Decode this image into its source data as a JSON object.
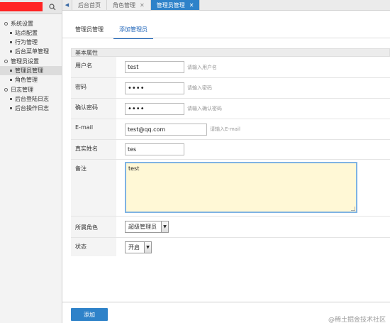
{
  "sidebar": {
    "groups": [
      {
        "label": "系统设置",
        "items": [
          "站点配置",
          "行为管理",
          "后台菜单管理"
        ]
      },
      {
        "label": "管理员设置",
        "items": [
          "管理员管理",
          "角色管理"
        ]
      },
      {
        "label": "日志管理",
        "items": [
          "后台登陆日志",
          "后台操作日志"
        ]
      }
    ],
    "active_item": "管理员管理",
    "search_icon": "search-icon"
  },
  "tabs": [
    {
      "label": "后台首页",
      "closable": false,
      "active": false
    },
    {
      "label": "角色管理",
      "closable": true,
      "active": false
    },
    {
      "label": "管理员管理",
      "closable": true,
      "active": true
    }
  ],
  "subtabs": [
    {
      "label": "管理员管理",
      "active": false
    },
    {
      "label": "添加管理员",
      "active": true
    }
  ],
  "form": {
    "section_title": "基本属性",
    "username": {
      "label": "用户名",
      "value": "test",
      "hint": "请输入用户名"
    },
    "password": {
      "label": "密码",
      "value": "••••",
      "hint": "请输入密码"
    },
    "confirm_password": {
      "label": "确认密码",
      "value": "••••",
      "hint": "请输入确认密码"
    },
    "email": {
      "label": "E-mail",
      "value": "test@qq.com",
      "hint": "请输入E-mail"
    },
    "real_name": {
      "label": "真实姓名",
      "value": "tes"
    },
    "remark": {
      "label": "备注",
      "value": "test"
    },
    "role": {
      "label": "所属角色",
      "value": "超级管理员"
    },
    "status": {
      "label": "状态",
      "value": "开启"
    }
  },
  "submit_label": "添加",
  "watermark": "@稀土掘金技术社区",
  "colors": {
    "accent": "#2e82c9",
    "textarea_bg": "#fff8d6",
    "redacted": "#ff2323"
  }
}
